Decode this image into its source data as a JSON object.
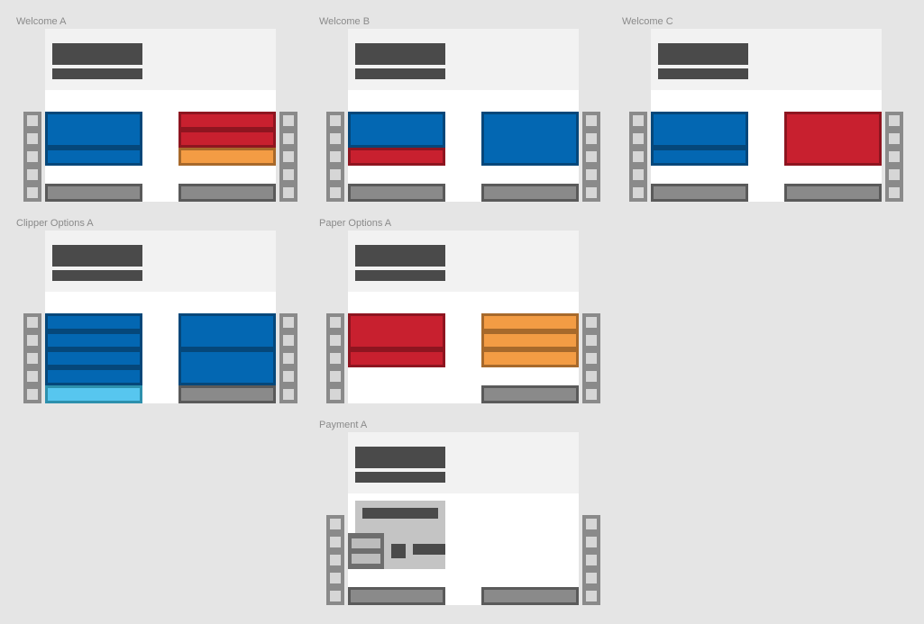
{
  "boards": {
    "welcome_a": {
      "title": "Welcome A"
    },
    "welcome_b": {
      "title": "Welcome B"
    },
    "welcome_c": {
      "title": "Welcome C"
    },
    "clipper_options_a": {
      "title": "Clipper Options A"
    },
    "paper_options_a": {
      "title": "Paper Options A"
    },
    "payment_a": {
      "title": "Payment A"
    }
  },
  "colors": {
    "background": "#e5e5e5",
    "header": "#f2f2f2",
    "body": "#ffffff",
    "dark_bar": "#4a4a4a",
    "blue": "#0367b2",
    "red": "#c8202f",
    "orange": "#f39c44",
    "light_blue": "#57c6ef",
    "gray_button": "#8a8a8a"
  }
}
